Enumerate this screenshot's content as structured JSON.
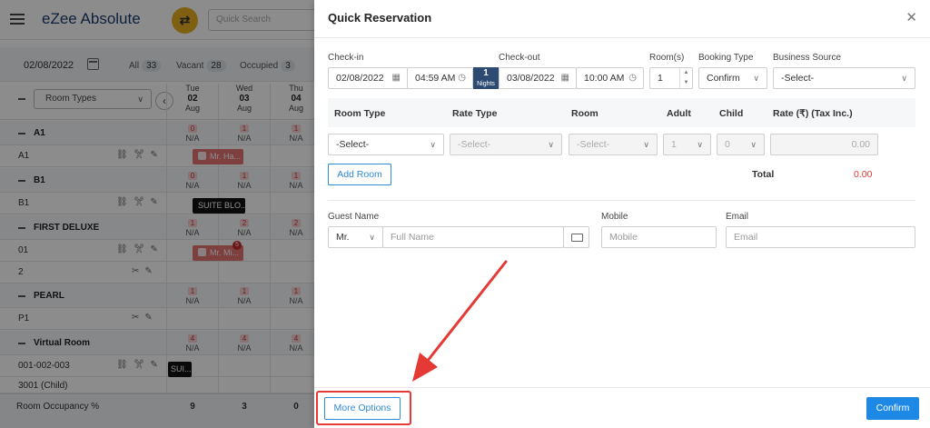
{
  "app": {
    "logo": "eZee Absolute",
    "search_placeholder": "Quick Search"
  },
  "filter": {
    "date": "02/08/2022",
    "stats": [
      {
        "label": "All",
        "count": "33"
      },
      {
        "label": "Vacant",
        "count": "28"
      },
      {
        "label": "Occupied",
        "count": "3"
      }
    ]
  },
  "grid": {
    "room_types_label": "Room Types",
    "days": [
      {
        "dow": "Tue",
        "day": "02",
        "month": "Aug"
      },
      {
        "dow": "Wed",
        "day": "03",
        "month": "Aug"
      },
      {
        "dow": "Thu",
        "day": "04",
        "month": "Aug"
      }
    ],
    "na": "N/A",
    "rows": [
      {
        "type": "group",
        "label": "A1",
        "avail": [
          "0",
          "1",
          "1"
        ]
      },
      {
        "type": "item",
        "label": "A1"
      },
      {
        "type": "group",
        "label": "B1",
        "avail": [
          "0",
          "1",
          "1"
        ]
      },
      {
        "type": "item",
        "label": "B1"
      },
      {
        "type": "group",
        "label": "FIRST DELUXE",
        "avail": [
          "1",
          "2",
          "2"
        ]
      },
      {
        "type": "item",
        "label": "01"
      },
      {
        "type": "item",
        "label": "2"
      },
      {
        "type": "group",
        "label": "PEARL",
        "avail": [
          "1",
          "1",
          "1"
        ]
      },
      {
        "type": "item",
        "label": "P1"
      },
      {
        "type": "group",
        "label": "Virtual Room",
        "avail": [
          "4",
          "4",
          "4"
        ]
      },
      {
        "type": "item",
        "label": "001-002-003"
      },
      {
        "type": "item",
        "label": "3001 (Child)"
      }
    ],
    "bookings": {
      "a1": "Mr. Ha...",
      "b1": "SUITE BLO...",
      "fd": "Mr. Mi...",
      "fd_badge": "5",
      "vr": "SUI..."
    },
    "occupancy_label": "Room Occupancy %",
    "occupancy": [
      "9",
      "3",
      "0"
    ]
  },
  "modal": {
    "title": "Quick Reservation",
    "checkin_label": "Check-in",
    "checkin_date": "02/08/2022",
    "checkin_time": "04:59 AM",
    "nights_count": "1",
    "nights_label": "Nights",
    "checkout_label": "Check-out",
    "checkout_date": "03/08/2022",
    "checkout_time": "10:00 AM",
    "rooms_label": "Room(s)",
    "rooms_value": "1",
    "booking_type_label": "Booking Type",
    "booking_type_value": "Confirm",
    "business_source_label": "Business Source",
    "business_source_value": "-Select-",
    "table_headers": {
      "room_type": "Room Type",
      "rate_type": "Rate Type",
      "room": "Room",
      "adult": "Adult",
      "child": "Child",
      "rate": "Rate (₹)  (Tax Inc.)"
    },
    "row": {
      "room_type": "-Select-",
      "rate_type": "-Select-",
      "room": "-Select-",
      "adult": "1",
      "child": "0",
      "rate": "0.00"
    },
    "add_room": "Add Room",
    "total_label": "Total",
    "total_value": "0.00",
    "guest_name_label": "Guest Name",
    "salutation": "Mr.",
    "full_name_placeholder": "Full Name",
    "mobile_label": "Mobile",
    "mobile_placeholder": "Mobile",
    "email_label": "Email",
    "email_placeholder": "Email",
    "more_options": "More Options",
    "confirm": "Confirm"
  },
  "colors": {
    "accent": "#1e88e5",
    "annotation": "#e53935",
    "nights_bg": "#2d4a72"
  }
}
